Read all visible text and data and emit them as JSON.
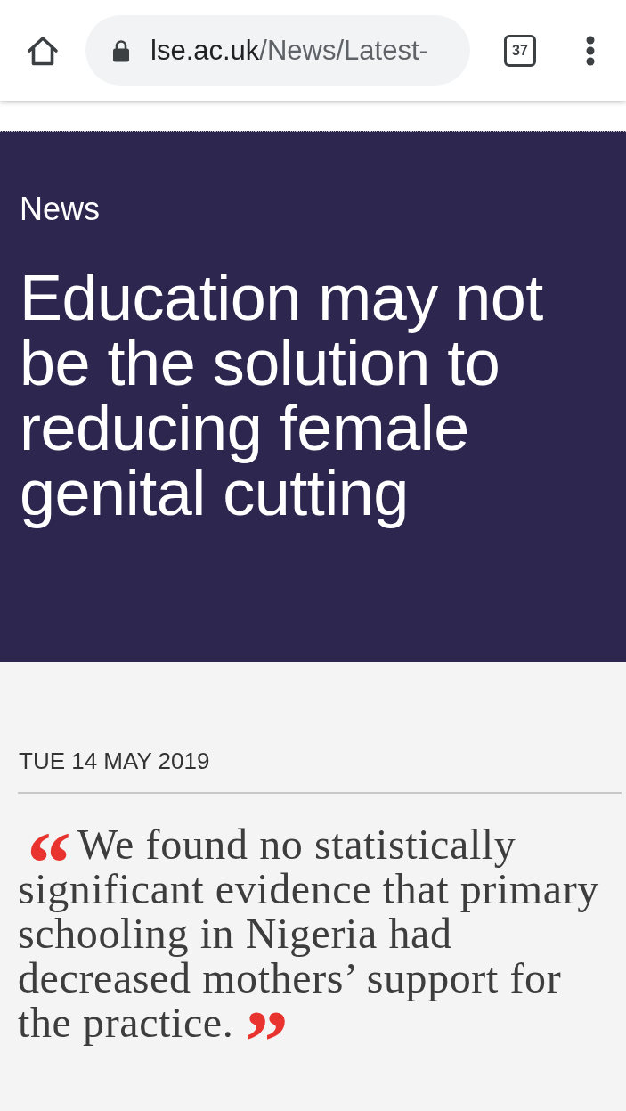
{
  "browser": {
    "url_domain": "lse.ac.uk",
    "url_path": "/News/Latest-",
    "tab_count": "37"
  },
  "hero": {
    "section_label": "News",
    "headline": "Education may not be the solution to reducing female genital cutting"
  },
  "article": {
    "date": "TUE 14 MAY 2019",
    "quote_open": "“",
    "pull_quote": "We found no statistically significant evidence that primary schooling in Nigeria had decreased mothers’ support for the practice.",
    "quote_close": "”"
  }
}
